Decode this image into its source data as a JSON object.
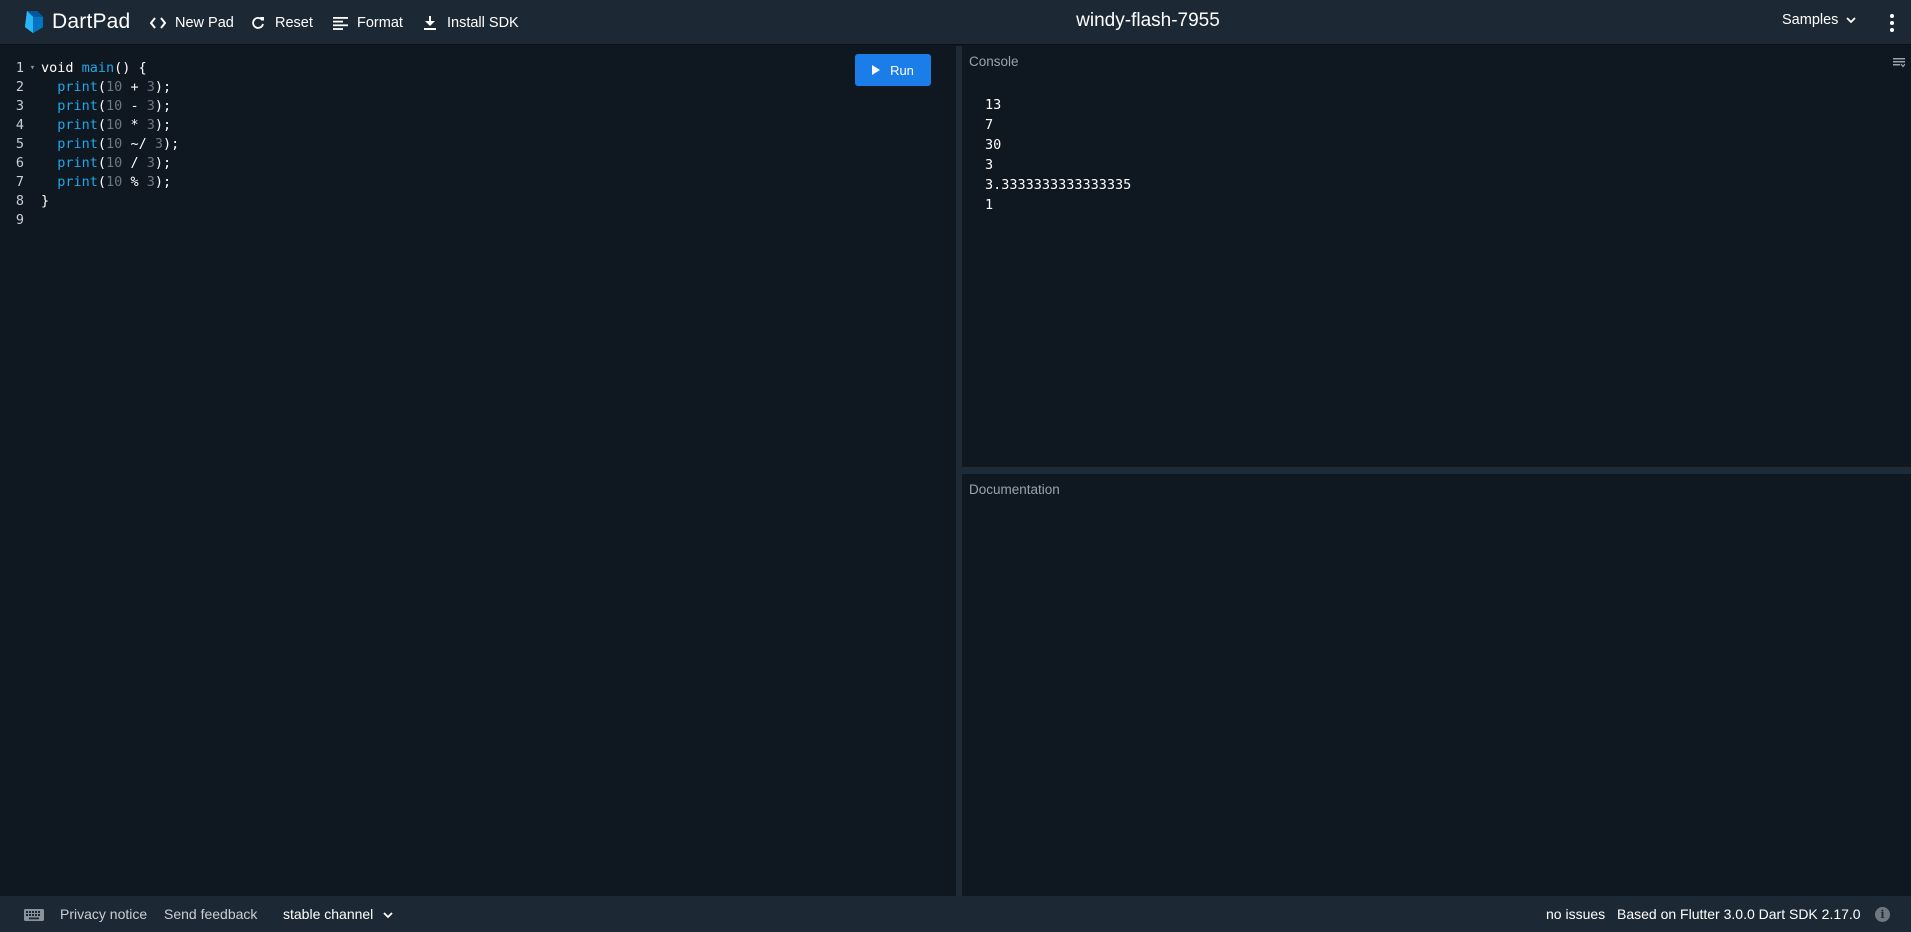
{
  "header": {
    "app_name": "DartPad",
    "pad_title": "windy-flash-7955",
    "buttons": {
      "new_pad": "New Pad",
      "reset": "Reset",
      "format": "Format",
      "install_sdk": "Install SDK"
    },
    "samples_label": "Samples",
    "icons": {
      "logo": "dart-logo-icon",
      "new_pad": "code-brackets-icon",
      "reset": "refresh-icon",
      "format": "align-left-icon",
      "install_sdk": "download-icon",
      "samples": "chevron-down-icon",
      "menu": "more-vert-icon"
    }
  },
  "editor": {
    "run_label": "Run",
    "lines": [
      {
        "n": "1",
        "tokens": [
          {
            "t": "void ",
            "c": "k"
          },
          {
            "t": "main",
            "c": "fn"
          },
          {
            "t": "() {",
            "c": "p"
          }
        ]
      },
      {
        "n": "2",
        "tokens": [
          {
            "t": "  ",
            "c": "p"
          },
          {
            "t": "print",
            "c": "fn"
          },
          {
            "t": "(",
            "c": "p"
          },
          {
            "t": "10",
            "c": "n"
          },
          {
            "t": " + ",
            "c": "p"
          },
          {
            "t": "3",
            "c": "n"
          },
          {
            "t": ");",
            "c": "p"
          }
        ]
      },
      {
        "n": "3",
        "tokens": [
          {
            "t": "  ",
            "c": "p"
          },
          {
            "t": "print",
            "c": "fn"
          },
          {
            "t": "(",
            "c": "p"
          },
          {
            "t": "10",
            "c": "n"
          },
          {
            "t": " - ",
            "c": "p"
          },
          {
            "t": "3",
            "c": "n"
          },
          {
            "t": ");",
            "c": "p"
          }
        ]
      },
      {
        "n": "4",
        "tokens": [
          {
            "t": "  ",
            "c": "p"
          },
          {
            "t": "print",
            "c": "fn"
          },
          {
            "t": "(",
            "c": "p"
          },
          {
            "t": "10",
            "c": "n"
          },
          {
            "t": " * ",
            "c": "p"
          },
          {
            "t": "3",
            "c": "n"
          },
          {
            "t": ");",
            "c": "p"
          }
        ]
      },
      {
        "n": "5",
        "tokens": [
          {
            "t": "  ",
            "c": "p"
          },
          {
            "t": "print",
            "c": "fn"
          },
          {
            "t": "(",
            "c": "p"
          },
          {
            "t": "10",
            "c": "n"
          },
          {
            "t": " ~/ ",
            "c": "p"
          },
          {
            "t": "3",
            "c": "n"
          },
          {
            "t": ");",
            "c": "p"
          }
        ]
      },
      {
        "n": "6",
        "tokens": [
          {
            "t": "  ",
            "c": "p"
          },
          {
            "t": "print",
            "c": "fn"
          },
          {
            "t": "(",
            "c": "p"
          },
          {
            "t": "10",
            "c": "n"
          },
          {
            "t": " / ",
            "c": "p"
          },
          {
            "t": "3",
            "c": "n"
          },
          {
            "t": ");",
            "c": "p"
          }
        ]
      },
      {
        "n": "7",
        "tokens": [
          {
            "t": "  ",
            "c": "p"
          },
          {
            "t": "print",
            "c": "fn"
          },
          {
            "t": "(",
            "c": "p"
          },
          {
            "t": "10",
            "c": "n"
          },
          {
            "t": " % ",
            "c": "p"
          },
          {
            "t": "3",
            "c": "n"
          },
          {
            "t": ");",
            "c": "p"
          }
        ]
      },
      {
        "n": "8",
        "tokens": [
          {
            "t": "}",
            "c": "p"
          }
        ]
      },
      {
        "n": "9",
        "tokens": []
      }
    ]
  },
  "console": {
    "title": "Console",
    "output": [
      "13",
      "7",
      "30",
      "3",
      "3.3333333333333335",
      "1"
    ]
  },
  "documentation": {
    "title": "Documentation"
  },
  "footer": {
    "privacy": "Privacy notice",
    "feedback": "Send feedback",
    "channel": "stable channel",
    "issues": "no issues",
    "version": "Based on Flutter 3.0.0 Dart SDK 2.17.0"
  },
  "colors": {
    "accent": "#1a7de8",
    "function": "#1fa7e6",
    "background": "#0f1721",
    "bar": "#1c2834"
  }
}
